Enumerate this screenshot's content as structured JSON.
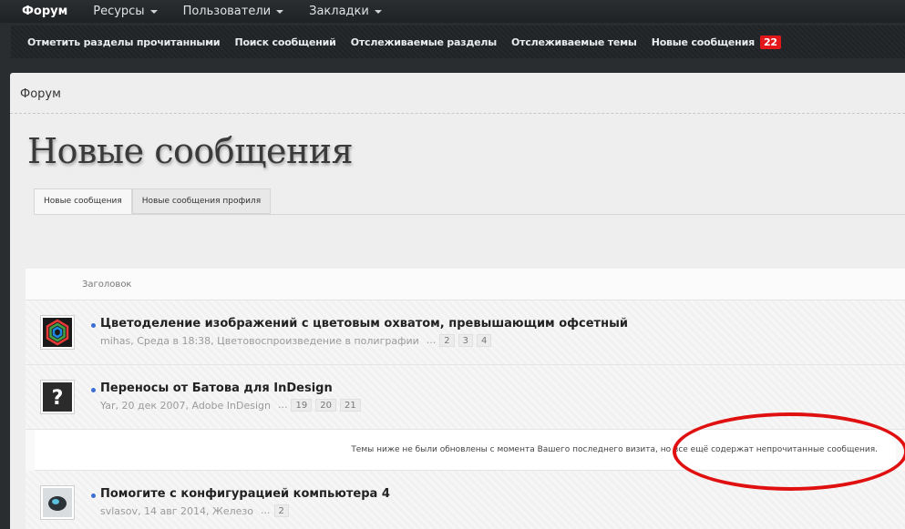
{
  "topnav": {
    "items": [
      {
        "label": "Форум",
        "active": true,
        "caret": false
      },
      {
        "label": "Ресурсы",
        "active": false,
        "caret": true
      },
      {
        "label": "Пользователи",
        "active": false,
        "caret": true
      },
      {
        "label": "Закладки",
        "active": false,
        "caret": true
      }
    ]
  },
  "subnav": {
    "items": [
      "Отметить разделы прочитанными",
      "Поиск сообщений",
      "Отслеживаемые разделы",
      "Отслеживаемые темы",
      "Новые сообщения"
    ],
    "badge": "22"
  },
  "breadcrumb": "Форум",
  "page_title": "Новые сообщения",
  "tabs": [
    "Новые сообщения",
    "Новые сообщения профиля"
  ],
  "list": {
    "header": "Заголовок",
    "threads": [
      {
        "title": "Цветоделение изображений с цветовым охватом, превышающим офсетный",
        "author": "mihas",
        "date": "Среда в 18:38",
        "forum": "Цветовоспроизведение в полиграфии",
        "ellipsis": "...",
        "pages": [
          "2",
          "3",
          "4"
        ]
      },
      {
        "title": "Переносы от Батова для InDesign",
        "author": "Yar",
        "date": "20 дек 2007",
        "forum": "Adobe InDesign",
        "ellipsis": "...",
        "pages": [
          "19",
          "20",
          "21"
        ]
      },
      {
        "title": "Помогите с конфигурацией компьютера 4",
        "author": "svlasov",
        "date": "14 авг 2014",
        "forum": "Железо",
        "ellipsis": "...",
        "pages": [
          "2"
        ]
      }
    ],
    "notice": "Темы ниже не были обновлены с момента Вашего последнего визита, но все ещё содержат непрочитанные сообщения."
  },
  "colors": {
    "badge": "#e3161a",
    "annotation": "#e01010",
    "unread_dot": "#3b6fd6"
  }
}
